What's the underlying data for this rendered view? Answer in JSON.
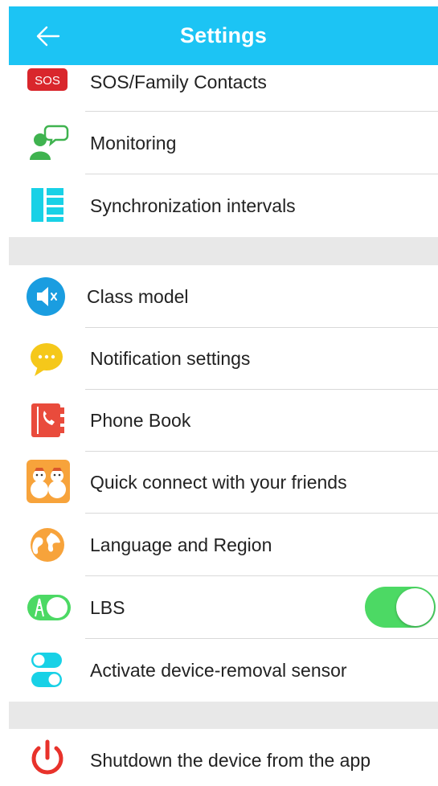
{
  "header": {
    "title": "Settings"
  },
  "items": [
    {
      "label": "SOS/Family Contacts",
      "badge": "SOS",
      "icon": "sos-icon"
    },
    {
      "label": "Monitoring",
      "icon": "monitoring-icon"
    },
    {
      "label": "Synchronization intervals",
      "icon": "sync-intervals-icon"
    },
    {
      "label": "Class model",
      "icon": "mute-speaker-icon"
    },
    {
      "label": "Notification settings",
      "icon": "chat-bubble-icon"
    },
    {
      "label": "Phone Book",
      "icon": "phone-book-icon"
    },
    {
      "label": "Quick connect with your friends",
      "icon": "friends-icon"
    },
    {
      "label": "Language and Region",
      "icon": "globe-icon"
    },
    {
      "label": "LBS",
      "icon": "location-tower-icon",
      "toggle_on": true
    },
    {
      "label": "Activate device-removal sensor",
      "icon": "sensor-switch-icon"
    },
    {
      "label": "Shutdown the device from the app",
      "icon": "power-icon"
    }
  ],
  "colors": {
    "header": "#1cc4f4",
    "toggle_on": "#4cd964",
    "section_gap": "#e8e8e8"
  }
}
